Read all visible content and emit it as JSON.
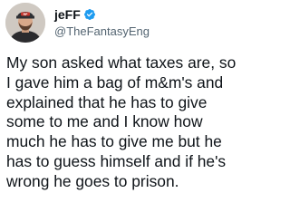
{
  "author": {
    "display_name": "jeFF",
    "handle": "@TheFantasyEng",
    "avatar_icon": "avatar-photo-icon",
    "verified_icon": "verified-badge-icon",
    "verified_color": "#1d9bf0"
  },
  "tweet": {
    "lines": [
      "My son asked what taxes are, so",
      "I gave him a bag of m&m's and",
      "explained that he has to give",
      "some to me and I know how",
      "much he has to give me but he",
      "has to guess himself and if he's",
      "wrong he goes to prison."
    ]
  },
  "colors": {
    "text": "#0f1419",
    "secondary": "#536471",
    "background": "#ffffff"
  }
}
